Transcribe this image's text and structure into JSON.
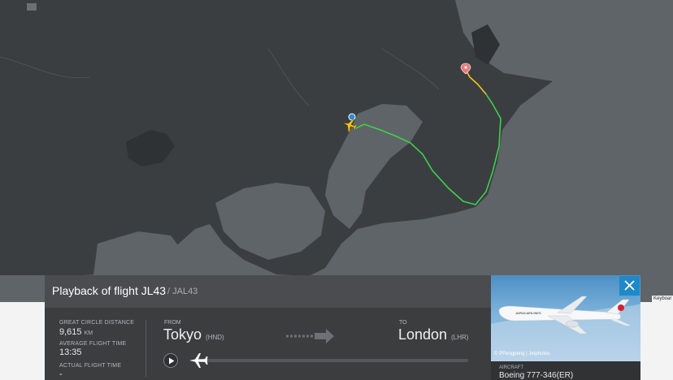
{
  "panel": {
    "title": "Playback of flight JL43",
    "callsign": "/ JAL43",
    "stats": {
      "distance_label": "GREAT CIRCLE DISTANCE",
      "distance_value": "9,615",
      "distance_unit": "KM",
      "avg_time_label": "AVERAGE FLIGHT TIME",
      "avg_time_value": "13:35",
      "actual_time_label": "ACTUAL FLIGHT TIME",
      "actual_time_value": "-"
    },
    "route": {
      "from_label": "FROM",
      "from_city": "Tokyo",
      "from_code": "(HND)",
      "to_label": "TO",
      "to_city": "London",
      "to_code": "(LHR)"
    },
    "playback_progress": 0
  },
  "aircraft": {
    "label": "AIRCRAFT",
    "value": "Boeing 777-346(ER)",
    "photo_credit": "© PPengpeng | Jetphotos",
    "livery_text": "JAPAN AIRLINES"
  },
  "keyboard_hint": "Keyboar",
  "icons": {
    "close": "close-icon",
    "play": "play-icon",
    "airplane": "airplane-icon",
    "origin_marker": "airport-marker-icon",
    "destination_marker": "destination-pin-icon",
    "arrow": "route-arrow-icon"
  },
  "colors": {
    "track_early": "#f2c71c",
    "track_late": "#3fd04b",
    "accent": "#1e88c9",
    "destination_pin": "#e87a7a"
  }
}
